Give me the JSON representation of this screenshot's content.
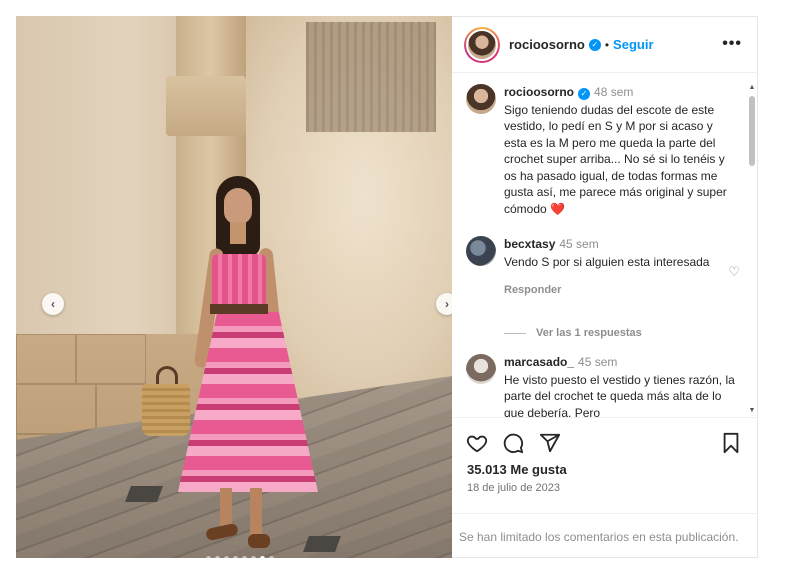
{
  "post": {
    "nav_prev": "‹",
    "nav_next": "›",
    "carousel": {
      "count": 8,
      "active_index": 6
    }
  },
  "header": {
    "username": "rocioosorno",
    "verified": "✓",
    "separator": "•",
    "follow_label": "Seguir",
    "more": "•••"
  },
  "comments": [
    {
      "user": "rocioosorno",
      "time": "48 sem",
      "text": "Sigo teniendo dudas del escote de este vestido, lo pedí en S y M por si acaso y esta es la M pero me queda la parte del crochet super arriba... No sé si lo tenéis y os ha pasado igual, de todas formas me gusta así, me parece más original y super cómodo ❤️"
    },
    {
      "user": "becxtasy",
      "time": "45 sem",
      "text": "Vendo S por si alguien esta interesada",
      "reply_label": "Responder",
      "view_replies": "Ver las 1 respuestas"
    },
    {
      "user": "marcasado_",
      "time": "45 sem",
      "text": "He visto puesto el vestido y tienes razón, la parte del crochet te queda más alta de lo que debería. Pero"
    }
  ],
  "actions": {
    "likes": "35.013 Me gusta",
    "date": "18 de julio de 2023"
  },
  "footer": {
    "limited_text": "Se han limitado los comentarios en esta publicación."
  },
  "colors": {
    "accent": "#0095f6",
    "muted": "#8e8e8e",
    "heart": "#e0245e"
  }
}
